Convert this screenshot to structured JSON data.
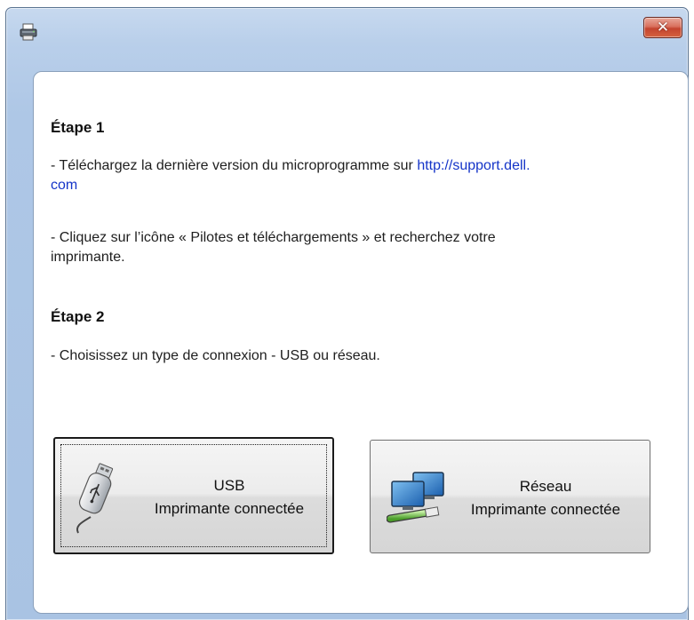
{
  "window": {
    "close_glyph": "✕"
  },
  "step1": {
    "title": "Étape 1",
    "download_prefix": "- Téléchargez la dernière version du microprogramme sur ",
    "download_link": "http://support.dell.",
    "download_link_cont": "com",
    "click_line1": "- Cliquez sur l’icône « Pilotes et téléchargements » et recherchez votre",
    "click_line2": "imprimante."
  },
  "step2": {
    "title": "Étape 2",
    "choose_text": "- Choisissez un type de connexion - USB ou réseau."
  },
  "buttons": {
    "usb": {
      "line1": "USB",
      "line2": "Imprimante connectée",
      "icon": "usb-drive-icon"
    },
    "network": {
      "line1": "Réseau",
      "line2": "Imprimante connectée",
      "icon": "network-computers-icon"
    }
  },
  "colors": {
    "link": "#1434c8",
    "frame": "#b9cfea",
    "close": "#c4442f"
  }
}
